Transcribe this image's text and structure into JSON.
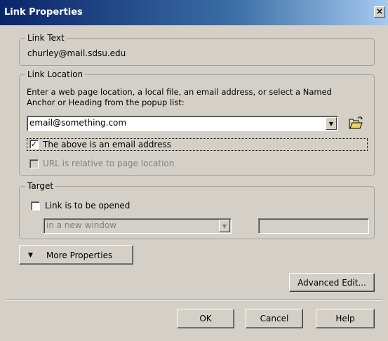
{
  "window": {
    "title": "Link Properties",
    "close": "×"
  },
  "link_text": {
    "legend": "Link Text",
    "value": "churley@mail.sdsu.edu"
  },
  "link_location": {
    "legend": "Link Location",
    "instructions_line1": "Enter a web page location, a local file, an email address, or select a Named",
    "instructions_line2": "Anchor or Heading from the popup list:",
    "url_value": "email@something.com",
    "email_checkbox_label": "The above is an email address",
    "email_checkbox_checked": true,
    "relative_checkbox_label": "URL is relative to page location",
    "relative_checkbox_checked": false
  },
  "target": {
    "legend": "Target",
    "open_checkbox_label": "Link is to be opened",
    "open_checkbox_checked": false,
    "window_select_value": "in a new window",
    "target_name_value": ""
  },
  "buttons": {
    "more_properties": "More Properties",
    "advanced_edit": "Advanced Edit...",
    "ok": "OK",
    "cancel": "Cancel",
    "help": "Help"
  }
}
